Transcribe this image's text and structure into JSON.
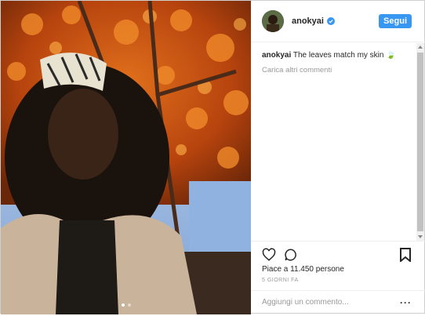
{
  "post": {
    "username": "anokyai",
    "follow_label": "Segui",
    "caption_user": "anokyai",
    "caption_text": "The leaves match my skin 🍃",
    "load_more": "Carica altri commenti",
    "likes": "Piace a 11.450 persone",
    "time": "5 GIORNI FA",
    "comment_placeholder": "Aggiungi un commento...",
    "more_label": "···"
  },
  "icons": {
    "verified": "verified-badge-icon",
    "like": "heart-icon",
    "comment": "comment-icon",
    "bookmark": "bookmark-icon"
  },
  "colors": {
    "accent": "#3897f0",
    "text": "#262626",
    "muted": "#999999"
  }
}
